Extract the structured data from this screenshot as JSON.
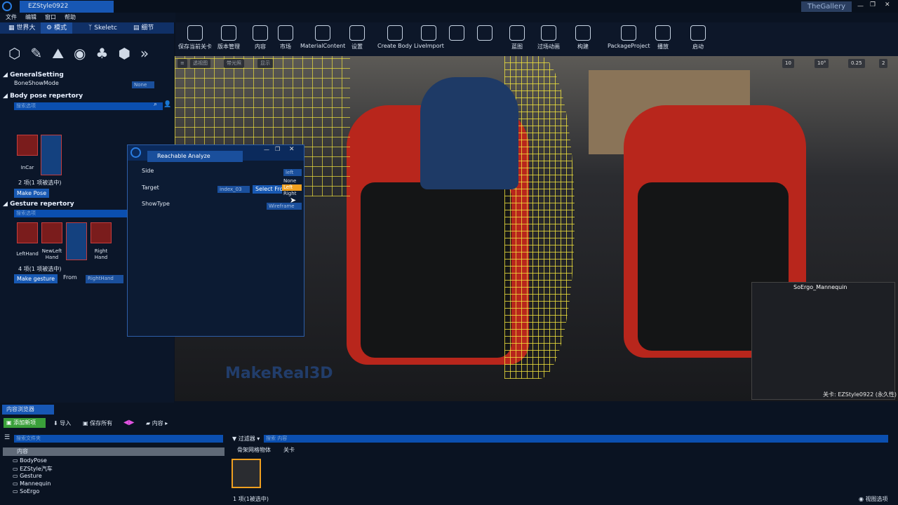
{
  "window": {
    "title": "EZStyle0922",
    "gallery": "TheGallery"
  },
  "menu": [
    "文件",
    "编辑",
    "窗口",
    "帮助"
  ],
  "left_tabs": [
    "世界大",
    "模式",
    "Skeletc",
    "细节"
  ],
  "general": {
    "heading": "GeneralSetting",
    "bone_label": "BoneShowMode",
    "bone_value": "None"
  },
  "body": {
    "heading": "Body pose repertory",
    "search": "搜索选项",
    "items": [
      "InCar",
      ""
    ],
    "count": "2 项(1 项被选中)",
    "button": "Make Pose"
  },
  "gesture": {
    "heading": "Gesture repertory",
    "search": "搜索选项",
    "items": [
      "LeftHand",
      "NewLeft Hand",
      "",
      "Right Hand"
    ],
    "count": "4 项(1 项被选中)",
    "button": "Make gesture",
    "from": "From",
    "from_value": "RightHand"
  },
  "toolbar": [
    "保存当前关卡",
    "版本管理",
    "内容",
    "市场",
    "MaterialContent",
    "设置",
    "Create Body",
    "LiveImport",
    "",
    "",
    "蓝图",
    "过场动画",
    "构建",
    "PackageProject",
    "播放",
    "启动"
  ],
  "viewport": {
    "btns": [
      "透视图",
      "带光照",
      "显示"
    ],
    "snap1": "10",
    "snap2": "10°",
    "scale": "0.25",
    "cams": "2",
    "brand": "MakeReal3D",
    "mannequin": "SoErgo_Mannequin",
    "level": "关卡: EZStyle0922 (永久性)"
  },
  "dialog": {
    "title": "Reachable Analyze",
    "side_label": "Side",
    "side_value": "left",
    "target_label": "Target",
    "target_value": "index_03",
    "select_btn": "Select From",
    "show_label": "ShowType",
    "show_value": "Wireframe",
    "options": [
      "None",
      "Left",
      "Right"
    ]
  },
  "content": {
    "tab": "内容浏览器",
    "add": "添加新项",
    "import": "导入",
    "save": "保存所有",
    "path": "内容",
    "folder_search": "搜索文件夹",
    "filter": "过滤器",
    "asset_search": "搜索 内容",
    "tags": [
      "骨架网格物体",
      "关卡"
    ],
    "root": "内容",
    "folders": [
      "BodyPose",
      "EZStyle汽车",
      "Gesture",
      "Mannequin",
      "SoErgo"
    ],
    "count": "1 项(1被选中)",
    "view": "视图选项"
  }
}
